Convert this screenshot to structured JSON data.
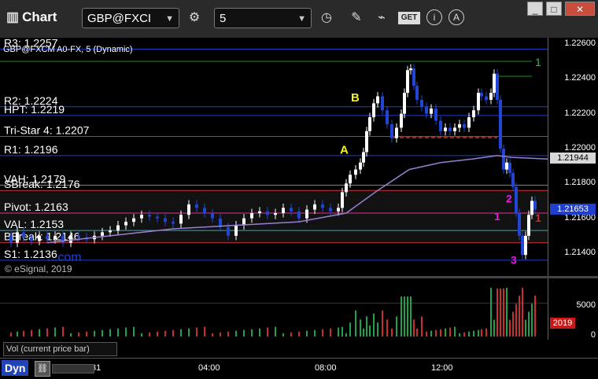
{
  "window": {
    "title": "Chart",
    "symbol": "GBP@FXCI",
    "interval": "5",
    "buttons": {
      "minimize": "_",
      "restore": "□",
      "close": "✕",
      "edit": "✎"
    },
    "icons": [
      "gear-icon",
      "clock-icon",
      "pencil-icon",
      "line-chart-icon",
      "get-icon",
      "info-icon",
      "alert-icon"
    ],
    "get_label": "GET"
  },
  "chart": {
    "series_label": "GBP@FXCM A0-FX, 5 (Dynamic)",
    "copyright": "© eSignal, 2019",
    "watermark": "...com",
    "levels": [
      {
        "label": "R3: 1.2257",
        "value": 1.2257,
        "color": "#1e3fd0"
      },
      {
        "label": "R2: 1.2224",
        "value": 1.2224,
        "color": "#1e3fd0"
      },
      {
        "label": "HPT: 1.2219",
        "value": 1.2219,
        "color": "#1e3fd0"
      },
      {
        "label": "Tri-Star 4: 1.2207",
        "value": 1.2207,
        "color": "#1b8c2b"
      },
      {
        "label": "R1: 1.2196",
        "value": 1.2196,
        "color": "#1e3fd0"
      },
      {
        "label": "VAH: 1.2179",
        "value": 1.2179,
        "color": "#22a9a9"
      },
      {
        "label": "SBreak: 1.2176",
        "value": 1.2176,
        "color": "#d42a2a"
      },
      {
        "label": "Pivot: 1.2163",
        "value": 1.2163,
        "color": "#e0208a"
      },
      {
        "label": "VAL: 1.2153",
        "value": 1.2153,
        "color": "#22a9a9"
      },
      {
        "label": "BBreak: 1.2146",
        "value": 1.2146,
        "color": "#d42a2a"
      },
      {
        "label": "S1: 1.2136",
        "value": 1.2136,
        "color": "#1e3fd0"
      }
    ],
    "price_ticks": [
      "1.22600",
      "1.22400",
      "1.22200",
      "1.22000",
      "1.21800",
      "1.21600",
      "1.21400"
    ],
    "current_price": "1.21653",
    "vwap_price": "1.21944",
    "vol_ticks": [
      "5000",
      "0"
    ],
    "vol_badge": "2019",
    "vol_label": "Vol (current price bar)",
    "time_ticks": [
      "31",
      "04:00",
      "08:00",
      "12:00"
    ],
    "pattern_labels": [
      "A",
      "B"
    ],
    "pattern_counts": [
      "1",
      "2",
      "3"
    ],
    "right_marker": "1",
    "dyn_label": "Dyn"
  },
  "colors": {
    "up_bar": "#ffffff",
    "down_bar": "#2146d6",
    "vwap": "#9a7fd0",
    "vol_up": "#1ea34a",
    "vol_down": "#c83030",
    "count_green": "#22c25a",
    "pattern_yellow": "#f2f225",
    "magenta": "#e01ee0",
    "badge_blue": "#1e3fd0",
    "badge_red": "#c81818"
  }
}
